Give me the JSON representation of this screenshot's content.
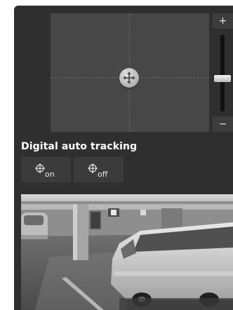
{
  "ptz": {
    "zoom_plus": "+",
    "zoom_minus": "−",
    "zoom_level": 0.42
  },
  "tracking": {
    "title": "Digital auto tracking",
    "on_label": "on",
    "off_label": "off"
  },
  "colors": {
    "panel_bg": "#2f2f2f",
    "pad_bg": "#474747",
    "title_text": "#ffffff"
  },
  "icons": {
    "pad_handle": "move-arrows-icon",
    "tracking_on": "target-on-icon",
    "tracking_off": "target-off-icon"
  }
}
